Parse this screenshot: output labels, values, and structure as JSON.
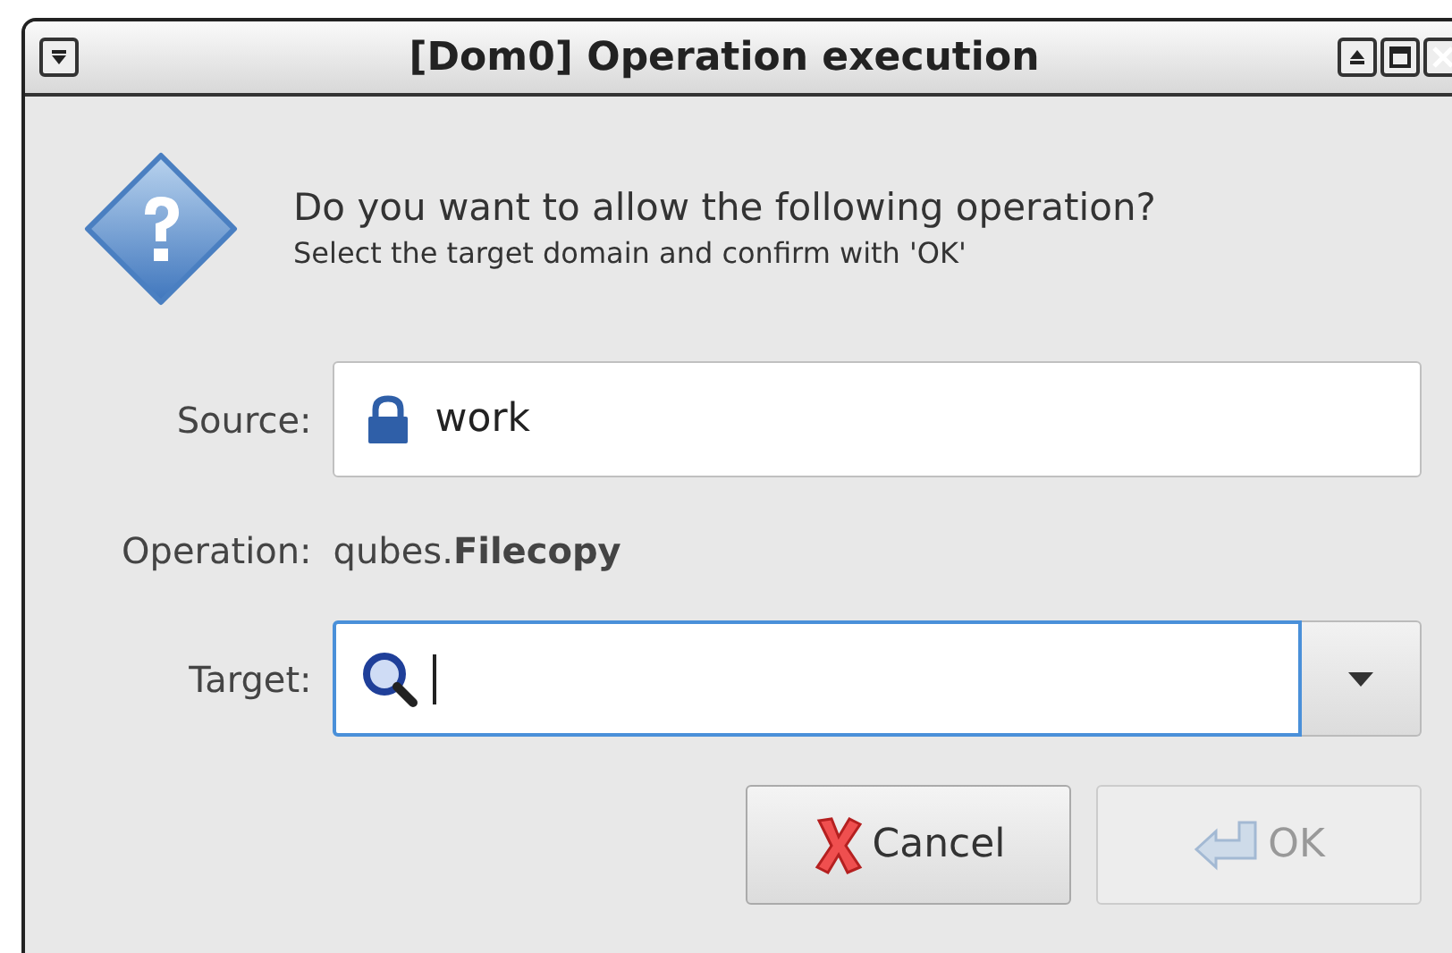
{
  "window": {
    "title": "[Dom0] Operation execution"
  },
  "prompt": {
    "heading": "Do you want to allow the following operation?",
    "subheading": "Select the target domain and confirm with 'OK'"
  },
  "source": {
    "label": "Source:",
    "value": "work"
  },
  "operation": {
    "label": "Operation:",
    "value": "qubes.**Filecopy**"
  },
  "target": {
    "label": "Target:",
    "focused": true
  },
  "buttons": [
    {
      "kind": "cancel",
      "label": "Cancel",
      "disabled": false
    },
    {
      "kind": "ok",
      "label": "OK",
      "disabled": true
    }
  ]
}
